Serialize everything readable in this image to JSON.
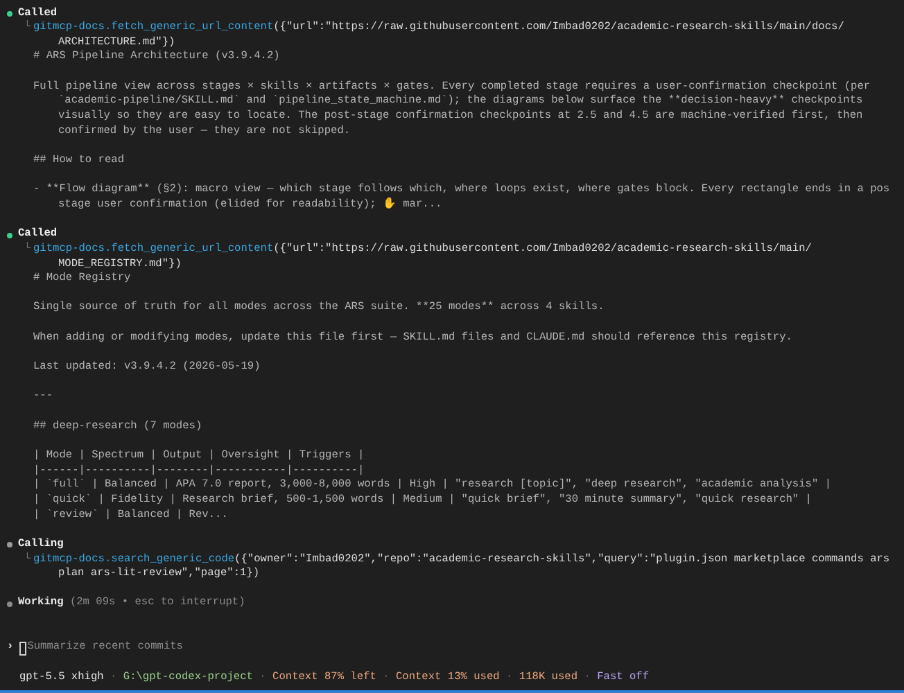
{
  "blocks": [
    {
      "kind": "tool_call",
      "status": "Called",
      "complete": true,
      "branch": "└",
      "tool": "gitmcp-docs.fetch_generic_url_content",
      "args": [
        "({\"url\":\"https://raw.githubusercontent.com/Imbad0202/academic-research-skills/main/docs/",
        "ARCHITECTURE.md\"})"
      ],
      "output": [
        {
          "kind": "text",
          "lines": [
            "# ARS Pipeline Architecture (v3.9.4.2)"
          ]
        },
        {
          "kind": "text",
          "lines": [
            "Full pipeline view across stages × skills × artifacts × gates. Every completed stage requires a user-confirmation checkpoint (per",
            "`academic-pipeline/SKILL.md` and `pipeline_state_machine.md`); the diagrams below surface the **decision-heavy** checkpoints",
            "visually so they are easy to locate. The post-stage confirmation checkpoints at 2.5 and 4.5 are machine-verified first, then",
            "confirmed by the user — they are not skipped."
          ]
        },
        {
          "kind": "text",
          "lines": [
            "## How to read"
          ]
        },
        {
          "kind": "text",
          "lines": [
            "- **Flow diagram** (§2): macro view — which stage follows which, where loops exist, where gates block. Every rectangle ends in a pos",
            "stage user confirmation (elided for readability); ✋ mar..."
          ]
        }
      ]
    },
    {
      "kind": "tool_call",
      "status": "Called",
      "complete": true,
      "branch": "└",
      "tool": "gitmcp-docs.fetch_generic_url_content",
      "args": [
        "({\"url\":\"https://raw.githubusercontent.com/Imbad0202/academic-research-skills/main/",
        "MODE_REGISTRY.md\"})"
      ],
      "output": [
        {
          "kind": "text",
          "lines": [
            "# Mode Registry"
          ]
        },
        {
          "kind": "text",
          "lines": [
            "Single source of truth for all modes across the ARS suite. **25 modes** across 4 skills."
          ]
        },
        {
          "kind": "text",
          "lines": [
            "When adding or modifying modes, update this file first — SKILL.md files and CLAUDE.md should reference this registry."
          ]
        },
        {
          "kind": "text",
          "lines": [
            "Last updated: v3.9.4.2 (2026-05-19)"
          ]
        },
        {
          "kind": "text",
          "lines": [
            "---"
          ]
        },
        {
          "kind": "text",
          "lines": [
            "## deep-research (7 modes)"
          ]
        },
        {
          "kind": "table",
          "lines": [
            "| Mode | Spectrum | Output | Oversight | Triggers |",
            "|------|----------|--------|-----------|----------|",
            "| `full` | Balanced | APA 7.0 report, 3,000-8,000 words | High | \"research [topic]\", \"deep research\", \"academic analysis\" |",
            "| `quick` | Fidelity | Research brief, 500-1,500 words | Medium | \"quick brief\", \"30 minute summary\", \"quick research\" |",
            "| `review` | Balanced | Rev..."
          ]
        }
      ]
    },
    {
      "kind": "tool_call",
      "status": "Calling",
      "complete": false,
      "branch": "└",
      "tool": "gitmcp-docs.search_generic_code",
      "args": [
        "({\"owner\":\"Imbad0202\",\"repo\":\"academic-research-skills\",\"query\":\"plugin.json marketplace commands ars",
        "plan ars-lit-review\",\"page\":1})"
      ]
    }
  ],
  "working": {
    "label": "Working",
    "detail": "(2m 09s • esc to interrupt)"
  },
  "prompt": {
    "marker": "›",
    "placeholder": "Summarize recent commits"
  },
  "status_bar": [
    {
      "kind": "text",
      "text": "gpt-5.5 xhigh",
      "color": "#e6e6e6"
    },
    {
      "kind": "separator",
      "text": "·"
    },
    {
      "kind": "text",
      "text": "G:\\gpt-codex-project",
      "color": "#9bd08a"
    },
    {
      "kind": "separator",
      "text": "·"
    },
    {
      "kind": "text",
      "text": "Context 87% left",
      "color": "#eaa77f"
    },
    {
      "kind": "separator",
      "text": "·"
    },
    {
      "kind": "text",
      "text": "Context 13% used",
      "color": "#eaa77f"
    },
    {
      "kind": "separator",
      "text": "·"
    },
    {
      "kind": "text",
      "text": "118K used",
      "color": "#eaa77f"
    },
    {
      "kind": "separator",
      "text": "·"
    },
    {
      "kind": "text",
      "text": "Fast off",
      "color": "#b9a4f2"
    }
  ]
}
